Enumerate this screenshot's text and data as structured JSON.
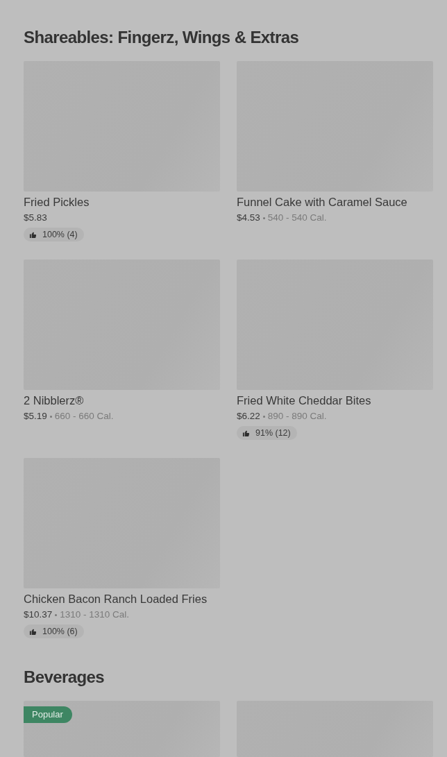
{
  "sections": [
    {
      "title": "Shareables: Fingerz, Wings & Extras",
      "items": [
        {
          "kind": "card",
          "name": "Fried Pickles",
          "price": "$5.83",
          "rating": "100% (4)"
        },
        {
          "kind": "card",
          "name": "Funnel Cake with Caramel Sauce",
          "price": "$4.53",
          "calories": "540 - 540 Cal."
        },
        {
          "kind": "card",
          "name": "2 Nibblerz®",
          "price": "$5.19",
          "calories": "660 - 660 Cal."
        },
        {
          "kind": "card",
          "name": "Fried White Cheddar Bites",
          "price": "$6.22",
          "calories": "890 - 890 Cal.",
          "rating": "91% (12)"
        },
        {
          "kind": "card",
          "name": "Chicken Bacon Ranch Loaded Fries",
          "price": "$10.37",
          "calories": "1310 - 1310 Cal.",
          "rating": "100% (6)"
        }
      ]
    },
    {
      "title": "Beverages",
      "items": [
        {
          "kind": "card",
          "badge": "Popular"
        },
        {
          "kind": "card"
        }
      ]
    }
  ]
}
